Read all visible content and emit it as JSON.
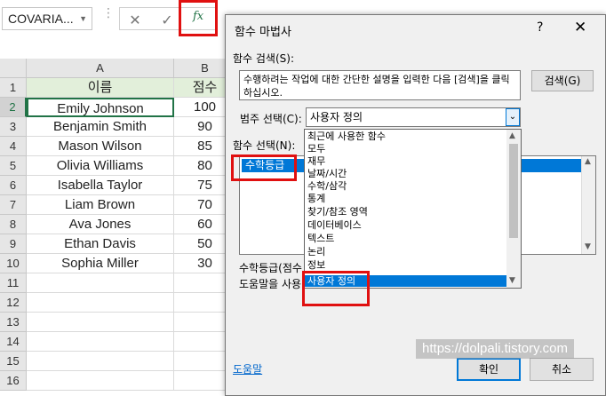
{
  "formula_bar": {
    "name_box": "COVARIA...",
    "cancel_glyph": "✕",
    "enter_glyph": "✓",
    "fx_label": "fx"
  },
  "sheet": {
    "columns": [
      "A",
      "B"
    ],
    "rows": [
      "1",
      "2",
      "3",
      "4",
      "5",
      "6",
      "7",
      "8",
      "9",
      "10",
      "11",
      "12",
      "13",
      "14",
      "15",
      "16"
    ],
    "header": {
      "name": "이름",
      "score": "점수"
    },
    "data": [
      {
        "name": "Emily Johnson",
        "score": "100"
      },
      {
        "name": "Benjamin Smith",
        "score": "90"
      },
      {
        "name": "Mason Wilson",
        "score": "85"
      },
      {
        "name": "Olivia Williams",
        "score": "80"
      },
      {
        "name": "Isabella Taylor",
        "score": "75"
      },
      {
        "name": "Liam Brown",
        "score": "70"
      },
      {
        "name": "Ava Jones",
        "score": "60"
      },
      {
        "name": "Ethan Davis",
        "score": "50"
      },
      {
        "name": "Sophia Miller",
        "score": "30"
      }
    ]
  },
  "dialog": {
    "title": "함수 마법사",
    "help": "?",
    "close": "✕",
    "search_label": "함수 검색(S):",
    "search_text": "수행하려는 작업에 대한 간단한 설명을 입력한 다음 [검색]을 클릭하십시오.",
    "search_button": "검색(G)",
    "category_label": "범주 선택(C):",
    "category_value": "사용자 정의",
    "function_label": "함수 선택(N):",
    "selected_function": "수학등급",
    "categories": [
      "최근에 사용한 함수",
      "모두",
      "재무",
      "날짜/시간",
      "수학/삼각",
      "통계",
      "찾기/참조 영역",
      "데이터베이스",
      "텍스트",
      "논리",
      "정보",
      "사용자 정의"
    ],
    "description_prefix": "수학등급(점수",
    "help_text_prefix": "도움말을 사용",
    "help_link": "도움말",
    "ok": "확인",
    "cancel": "취소"
  },
  "watermark": "https://dolpali.tistory.com"
}
